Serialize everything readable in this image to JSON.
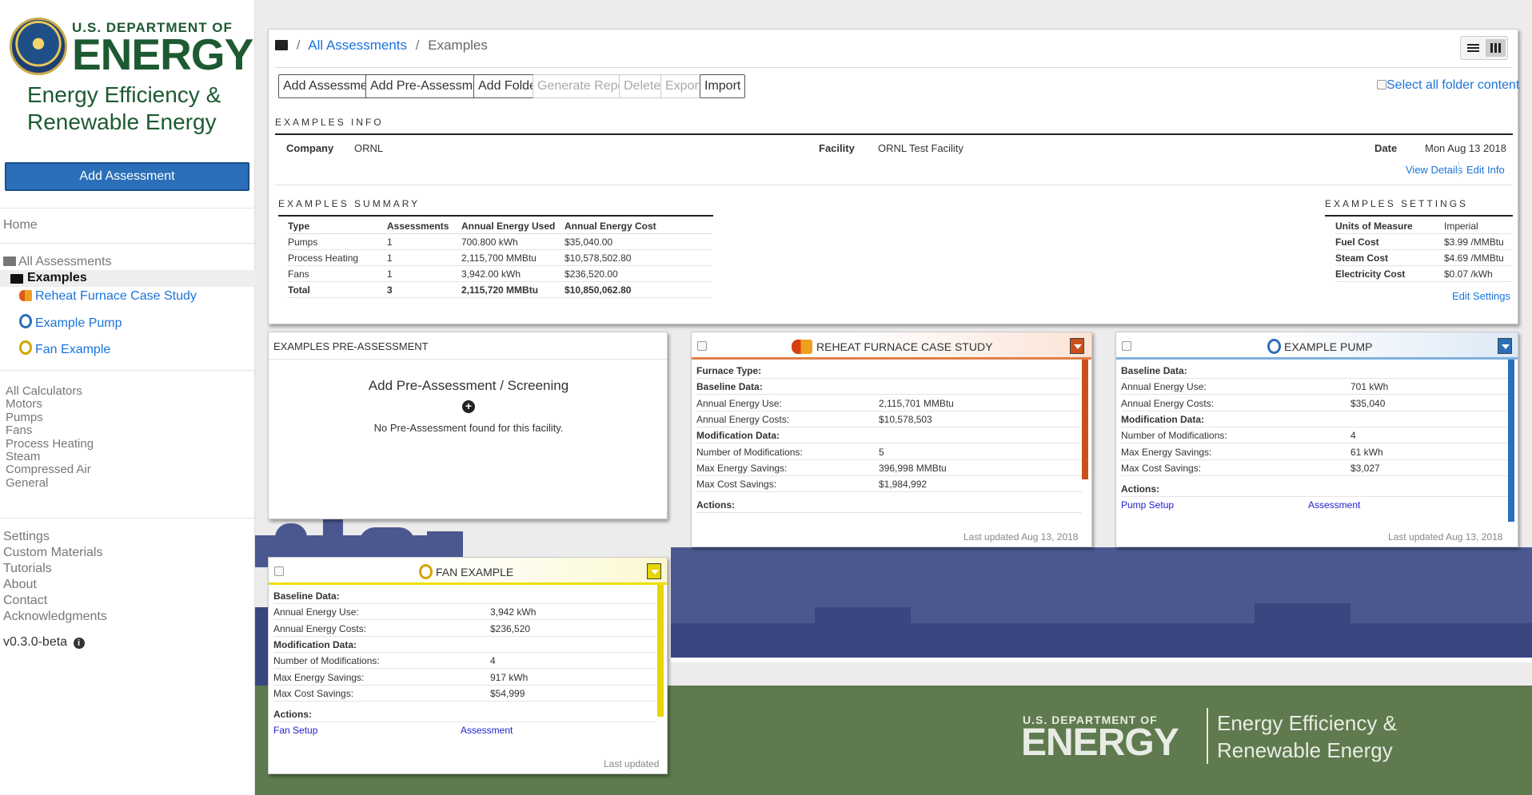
{
  "sidebar": {
    "logo": {
      "dept": "U.S. DEPARTMENT OF",
      "energy": "ENERGY",
      "eere_line1": "Energy Efficiency &",
      "eere_line2": "Renewable Energy"
    },
    "add_assessment": "Add Assessment",
    "home": "Home",
    "all_assessments": "All Assessments",
    "examples": "Examples",
    "tree": [
      "Reheat Furnace Case Study",
      "Example Pump",
      "Fan Example"
    ],
    "calculators": [
      "All Calculators",
      "Motors",
      "Pumps",
      "Fans",
      "Process Heating",
      "Steam",
      "Compressed Air",
      "General"
    ],
    "misc": [
      "Settings",
      "Custom Materials",
      "Tutorials",
      "About",
      "Contact",
      "Acknowledgments"
    ],
    "version": "v0.3.0-beta"
  },
  "breadcrumb": {
    "root": "All Assessments",
    "sep": "/",
    "current": "Examples"
  },
  "toolbar": {
    "buttons": [
      "Add Assessment",
      "Add Pre-Assessment",
      "Add Folder",
      "Generate Report",
      "Delete",
      "Export",
      "Import"
    ],
    "select_all": "Select all folder content"
  },
  "info": {
    "title": "EXAMPLES INFO",
    "company_label": "Company",
    "company": "ORNL",
    "facility_label": "Facility",
    "facility": "ORNL Test Facility",
    "date_label": "Date",
    "date": "Mon Aug 13 2018",
    "view_details": "View Details",
    "edit_info": "Edit Info"
  },
  "summary": {
    "title": "EXAMPLES SUMMARY",
    "headers": [
      "Type",
      "Assessments",
      "Annual Energy Used",
      "Annual Energy Cost"
    ],
    "rows": [
      [
        "Pumps",
        "1",
        "700.800 kWh",
        "$35,040.00"
      ],
      [
        "Process Heating",
        "1",
        "2,115,700 MMBtu",
        "$10,578,502.80"
      ],
      [
        "Fans",
        "1",
        "3,942.00 kWh",
        "$236,520.00"
      ],
      [
        "Total",
        "3",
        "2,115,720 MMBtu",
        "$10,850,062.80"
      ]
    ]
  },
  "settings": {
    "title": "EXAMPLES SETTINGS",
    "rows": [
      [
        "Units of Measure",
        "Imperial"
      ],
      [
        "Fuel Cost",
        "$3.99 /MMBtu"
      ],
      [
        "Steam Cost",
        "$4.69 /MMBtu"
      ],
      [
        "Electricity Cost",
        "$0.07 /kWh"
      ]
    ],
    "edit": "Edit Settings"
  },
  "pre": {
    "header": "EXAMPLES PRE-ASSESSMENT",
    "add": "Add Pre-Assessment / Screening",
    "plus": "+",
    "none": "No Pre-Assessment found for this facility."
  },
  "furnace": {
    "title": "REHEAT FURNACE CASE STUDY",
    "rows": [
      [
        "Furnace Type:",
        ""
      ],
      [
        "Baseline Data:",
        ""
      ],
      [
        "Annual Energy Use:",
        "2,115,701 MMBtu"
      ],
      [
        "Annual Energy Costs:",
        "$10,578,503"
      ],
      [
        "Modification Data:",
        ""
      ],
      [
        "Number of Modifications:",
        "5"
      ],
      [
        "Max Energy Savings:",
        "396,998 MMBtu"
      ],
      [
        "Max Cost Savings:",
        "$1,984,992"
      ]
    ],
    "actions": "Actions:",
    "updated": "Last updated Aug 13, 2018"
  },
  "pump": {
    "title": "EXAMPLE PUMP",
    "rows": [
      [
        "Baseline Data:",
        ""
      ],
      [
        "Annual Energy Use:",
        "701 kWh"
      ],
      [
        "Annual Energy Costs:",
        "$35,040"
      ],
      [
        "Modification Data:",
        ""
      ],
      [
        "Number of Modifications:",
        "4"
      ],
      [
        "Max Energy Savings:",
        "61 kWh"
      ],
      [
        "Max Cost Savings:",
        "$3,027"
      ]
    ],
    "actions": "Actions:",
    "setup": "Pump Setup",
    "assessment": "Assessment",
    "updated": "Last updated Aug 13, 2018"
  },
  "fan": {
    "title": "FAN EXAMPLE",
    "rows": [
      [
        "Baseline Data:",
        ""
      ],
      [
        "Annual Energy Use:",
        "3,942 kWh"
      ],
      [
        "Annual Energy Costs:",
        "$236,520"
      ],
      [
        "Modification Data:",
        ""
      ],
      [
        "Number of Modifications:",
        "4"
      ],
      [
        "Max Energy Savings:",
        "917 kWh"
      ],
      [
        "Max Cost Savings:",
        "$54,999"
      ]
    ],
    "actions": "Actions:",
    "setup": "Fan Setup",
    "assessment": "Assessment",
    "updated": "Last updated"
  },
  "footer_logo": {
    "dept": "U.S. DEPARTMENT OF",
    "energy": "ENERGY",
    "eere_line1": "Energy Efficiency &",
    "eere_line2": "Renewable Energy"
  },
  "colors": {
    "brand_green": "#1d5a31",
    "link_blue": "#1a73d9",
    "furnace": "#c9501c",
    "pump": "#2a6fb8",
    "fan": "#e8d400"
  }
}
